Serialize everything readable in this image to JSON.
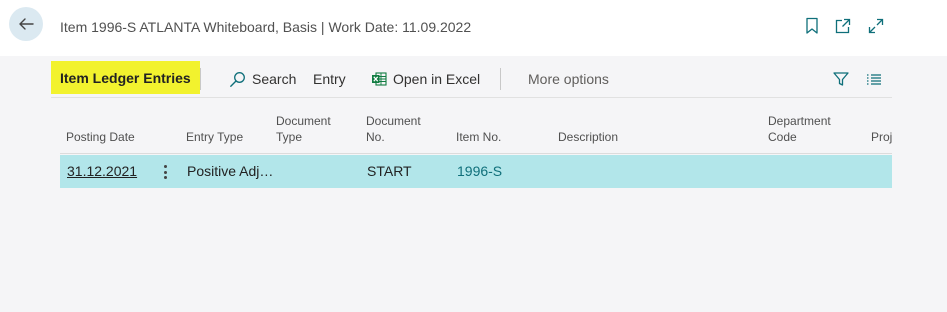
{
  "header": {
    "title": "Item 1996-S ATLANTA Whiteboard, Basis | Work Date: 11.09.2022",
    "icons": [
      "back-arrow-icon",
      "bookmark-icon",
      "open-new-window-icon",
      "expand-icon"
    ]
  },
  "actionbar": {
    "page_name": "Item Ledger Entries",
    "search_label": "Search",
    "entry_label": "Entry",
    "excel_label": "Open in Excel",
    "more_label": "More options",
    "icons": [
      "search-icon",
      "excel-icon",
      "filter-icon",
      "list-view-icon"
    ]
  },
  "columns": {
    "posting_date": "Posting Date",
    "entry_type": "Entry Type",
    "document_type_1": "Document",
    "document_type_2": "Type",
    "document_no_1": "Document",
    "document_no_2": "No.",
    "item_no": "Item No.",
    "description": "Description",
    "department_code_1": "Department",
    "department_code_2": "Code",
    "project": "Proj"
  },
  "rows": [
    {
      "posting_date": "31.12.2021",
      "entry_type": "Positive Adj…",
      "document_type": "",
      "document_no": "START",
      "item_no": "1996-S",
      "description": "",
      "department_code": ""
    }
  ],
  "colors": {
    "selected_row": "#b2e6ea",
    "highlight": "#f2f22e",
    "link": "#0f6f7a",
    "accent": "#0f6f7a"
  }
}
